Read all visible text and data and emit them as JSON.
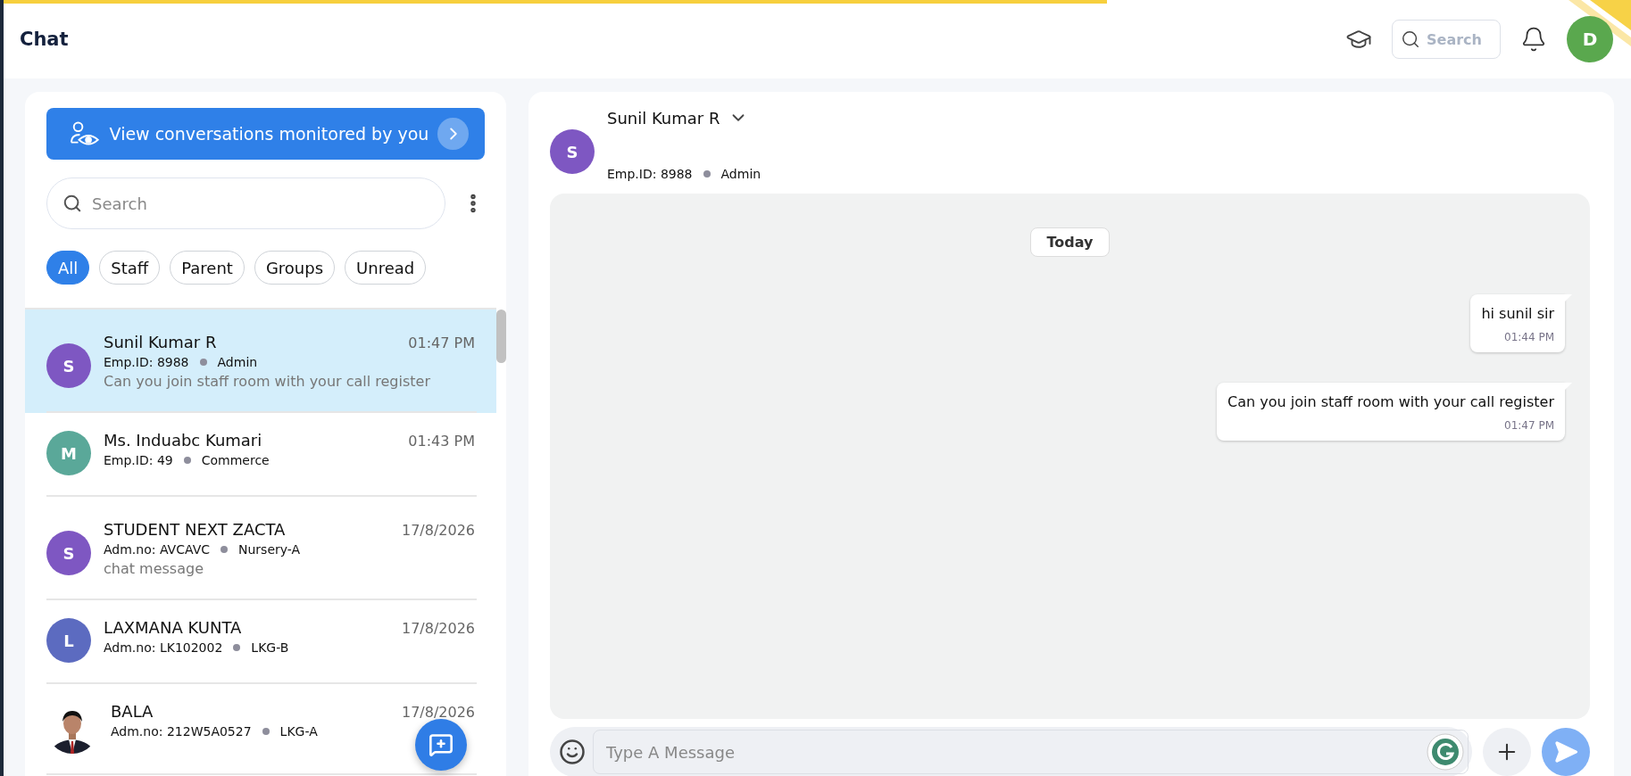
{
  "header": {
    "title": "Chat",
    "search": {
      "placeholder": "Search"
    },
    "user_avatar": {
      "initial": "D"
    }
  },
  "sidebar": {
    "monitor_button": "View conversations monitored by you",
    "search": {
      "placeholder": "Search"
    },
    "filters": [
      {
        "label": "All",
        "selected": true
      },
      {
        "label": "Staff",
        "selected": false
      },
      {
        "label": "Parent",
        "selected": false
      },
      {
        "label": "Groups",
        "selected": false
      },
      {
        "label": "Unread",
        "selected": false
      }
    ],
    "conversations": [
      {
        "kind": "initial",
        "initial": "S",
        "color": "#7e57c2",
        "name": "Sunil Kumar R",
        "time": "01:47 PM",
        "id_label": "Emp.ID: 8988",
        "group": "Admin",
        "preview": "Can you join staff room with your call register",
        "selected": true
      },
      {
        "kind": "initial",
        "initial": "M",
        "color": "#5aa899",
        "name": "Ms. Induabc Kumari",
        "time": "01:43 PM",
        "id_label": "Emp.ID: 49",
        "group": "Commerce",
        "selected": false
      },
      {
        "kind": "initial",
        "initial": "S",
        "color": "#7e57c2",
        "name": "STUDENT NEXT ZACTA",
        "time": "17/8/2026",
        "id_label": "Adm.no: AVCAVC",
        "group": "Nursery-A",
        "preview": "chat message",
        "selected": false
      },
      {
        "kind": "initial",
        "initial": "L",
        "color": "#5c6bc0",
        "name": "LAXMANA KUNTA",
        "time": "17/8/2026",
        "id_label": "Adm.no: LK102002",
        "group": "LKG-B",
        "selected": false
      },
      {
        "name": "BALA",
        "time": "17/8/2026",
        "id_label": "Adm.no: 212W5A0527",
        "group": "LKG-A",
        "selected": false
      }
    ]
  },
  "chat": {
    "contact": {
      "initial": "S",
      "color": "#7e57c2",
      "name": "Sunil Kumar R",
      "id_label": "Emp.ID: 8988",
      "group": "Admin"
    },
    "date_chip": "Today",
    "messages": [
      {
        "text": "hi sunil sir",
        "time": "01:44 PM"
      },
      {
        "text": "Can you join staff room with your call register",
        "time": "01:47 PM"
      }
    ],
    "composer": {
      "placeholder": "Type A Message"
    }
  }
}
